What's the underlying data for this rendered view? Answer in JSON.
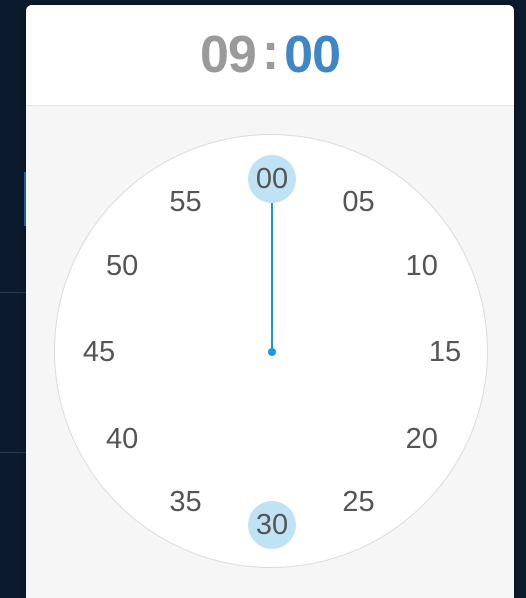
{
  "time_display": {
    "hour": "09",
    "separator": ":",
    "minute": "00"
  },
  "dial": {
    "mode": "minutes",
    "selected_minute": 0,
    "ticks": [
      {
        "label": "00",
        "minute": 0
      },
      {
        "label": "05",
        "minute": 5
      },
      {
        "label": "10",
        "minute": 10
      },
      {
        "label": "15",
        "minute": 15
      },
      {
        "label": "20",
        "minute": 20
      },
      {
        "label": "25",
        "minute": 25
      },
      {
        "label": "30",
        "minute": 30
      },
      {
        "label": "35",
        "minute": 35
      },
      {
        "label": "40",
        "minute": 40
      },
      {
        "label": "45",
        "minute": 45
      },
      {
        "label": "50",
        "minute": 50
      },
      {
        "label": "55",
        "minute": 55
      }
    ],
    "highlighted_minutes": [
      0,
      30
    ]
  },
  "colors": {
    "accent": "#3f86c7",
    "hand": "#1a9ad6",
    "highlight": "#bfe3f5",
    "muted_text": "#9a9a9a"
  }
}
